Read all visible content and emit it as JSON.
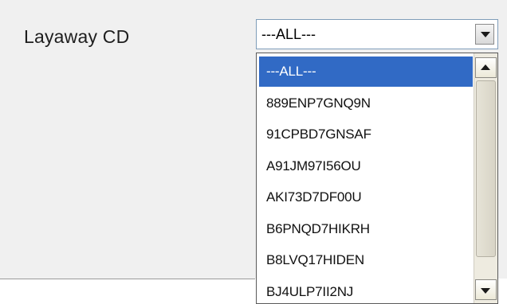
{
  "field": {
    "label": "Layaway CD"
  },
  "select": {
    "current_value": "---ALL---"
  },
  "dropdown": {
    "options": [
      {
        "label": "---ALL---",
        "selected": true
      },
      {
        "label": "889ENP7GNQ9N",
        "selected": false
      },
      {
        "label": "91CPBD7GNSAF",
        "selected": false
      },
      {
        "label": "A91JM97I56OU",
        "selected": false
      },
      {
        "label": "AKI73D7DF00U",
        "selected": false
      },
      {
        "label": "B6PNQD7HIKRH",
        "selected": false
      },
      {
        "label": "B8LVQ17HIDEN",
        "selected": false
      },
      {
        "label": "BJ4ULP7II2NJ",
        "selected": false
      }
    ]
  },
  "icons": {
    "select_arrow": "chevron-down-icon",
    "scroll_up": "arrow-up-icon",
    "scroll_down": "arrow-down-icon"
  },
  "colors": {
    "selection_highlight": "#316ac5",
    "panel_background": "#f0f0f0",
    "scrollbar_track": "#eeebe0"
  }
}
